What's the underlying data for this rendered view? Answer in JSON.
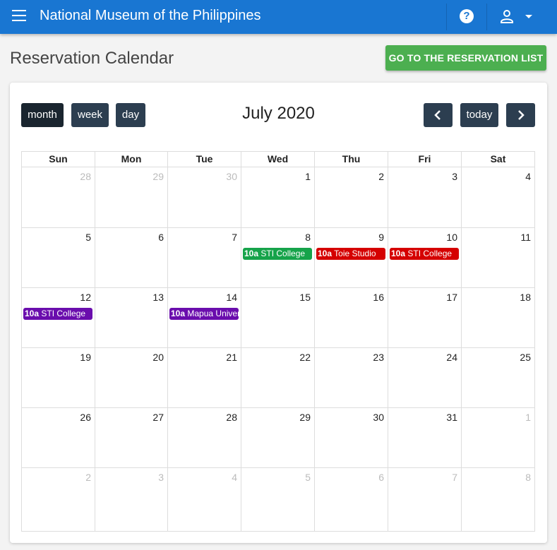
{
  "app": {
    "title": "National Museum of the Philippines"
  },
  "page": {
    "title": "Reservation Calendar",
    "goto_label": "GO TO THE RESERVATION LIST"
  },
  "toolbar": {
    "views": [
      "month",
      "week",
      "day"
    ],
    "active_view": "month",
    "title": "July 2020",
    "prev_symbol": "‹",
    "today_label": "today",
    "next_symbol": "›"
  },
  "colors": {
    "appbar": "#1976d2",
    "goto": "#4caf50",
    "button": "#2c3e50",
    "green": "#16a34a",
    "red": "#d50000",
    "purple": "#6a0dad"
  },
  "calendar": {
    "day_names": [
      "Sun",
      "Mon",
      "Tue",
      "Wed",
      "Thu",
      "Fri",
      "Sat"
    ],
    "weeks": [
      [
        {
          "n": "28",
          "o": true
        },
        {
          "n": "29",
          "o": true
        },
        {
          "n": "30",
          "o": true
        },
        {
          "n": "1"
        },
        {
          "n": "2"
        },
        {
          "n": "3"
        },
        {
          "n": "4"
        }
      ],
      [
        {
          "n": "5"
        },
        {
          "n": "6"
        },
        {
          "n": "7"
        },
        {
          "n": "8",
          "ev": {
            "time": "10a",
            "title": "STI College",
            "color": "#16a34a"
          }
        },
        {
          "n": "9",
          "ev": {
            "time": "10a",
            "title": "Toie Studio",
            "color": "#d50000"
          }
        },
        {
          "n": "10",
          "ev": {
            "time": "10a",
            "title": "STI College",
            "color": "#d50000"
          }
        },
        {
          "n": "11"
        }
      ],
      [
        {
          "n": "12",
          "ev": {
            "time": "10a",
            "title": "STI College",
            "color": "#6a0dad"
          }
        },
        {
          "n": "13"
        },
        {
          "n": "14",
          "ev": {
            "time": "10a",
            "title": "Mapua Univer",
            "color": "#6a0dad"
          }
        },
        {
          "n": "15"
        },
        {
          "n": "16"
        },
        {
          "n": "17"
        },
        {
          "n": "18"
        }
      ],
      [
        {
          "n": "19"
        },
        {
          "n": "20"
        },
        {
          "n": "21"
        },
        {
          "n": "22"
        },
        {
          "n": "23"
        },
        {
          "n": "24"
        },
        {
          "n": "25"
        }
      ],
      [
        {
          "n": "26"
        },
        {
          "n": "27"
        },
        {
          "n": "28"
        },
        {
          "n": "29"
        },
        {
          "n": "30"
        },
        {
          "n": "31"
        },
        {
          "n": "1",
          "o": true
        }
      ],
      [
        {
          "n": "2",
          "o": true
        },
        {
          "n": "3",
          "o": true
        },
        {
          "n": "4",
          "o": true
        },
        {
          "n": "5",
          "o": true
        },
        {
          "n": "6",
          "o": true
        },
        {
          "n": "7",
          "o": true
        },
        {
          "n": "8",
          "o": true
        }
      ]
    ]
  }
}
